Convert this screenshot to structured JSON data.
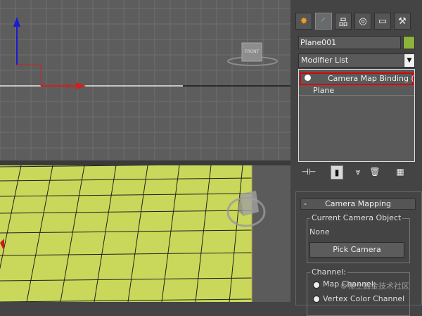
{
  "viewport_top": {
    "label": "FRONT"
  },
  "command_panel": {
    "tabs": [
      {
        "icon": "create-icon"
      },
      {
        "icon": "modify-icon"
      },
      {
        "icon": "hierarchy-icon"
      },
      {
        "icon": "motion-icon"
      },
      {
        "icon": "display-icon"
      },
      {
        "icon": "utilities-icon"
      }
    ],
    "object_name": "Plane001",
    "object_color": "#8cb43a",
    "modifier_list_label": "Modifier List",
    "stack": [
      {
        "label": "Camera Map Binding (WS",
        "selected": true
      },
      {
        "label": "Plane",
        "selected": false
      }
    ],
    "rollout": {
      "title": "Camera Mapping",
      "collapse_symbol": "-",
      "current_camera_label": "Current Camera Object",
      "current_camera_value": "None",
      "pick_camera_label": "Pick Camera",
      "channel_label": "Channel:",
      "channel_options": [
        "Map Channel:",
        "Vertex Color Channel"
      ]
    }
  },
  "watermark": "©稀土掘金技术社区",
  "colors": {
    "highlight": "#d80000",
    "plane_color": "#c9d85a"
  }
}
